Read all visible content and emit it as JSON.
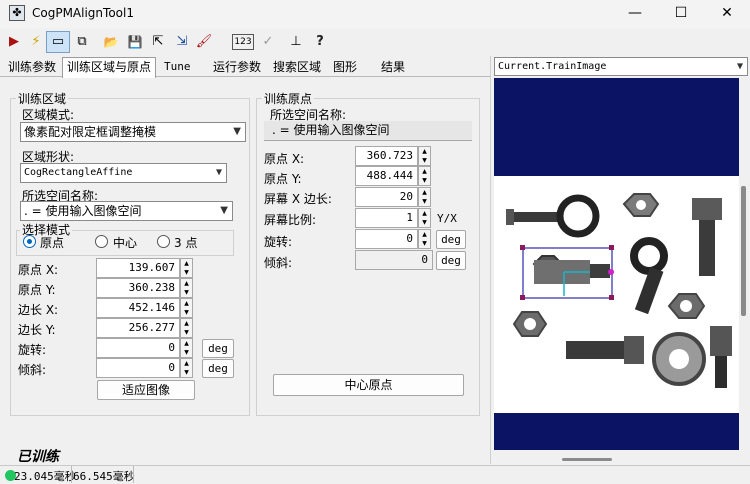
{
  "window": {
    "title": "CogPMAlignTool1",
    "minimize": "—",
    "maximize": "☐",
    "close": "✕"
  },
  "toolbar": {
    "icons": [
      "run-icon",
      "lightning-icon",
      "display-icon",
      "link-icon",
      "open-folder-icon",
      "save-icon",
      "export-icon",
      "import-icon",
      "brush-icon",
      "numeric-icon",
      "check-icon",
      "axis-icon",
      "help-icon"
    ],
    "run": "▶",
    "lightning": "⚡",
    "display": "▭",
    "link": "⧉",
    "open": "📂",
    "save": "💾",
    "export": "⇱",
    "import": "⇲",
    "brush": "🖌",
    "numeric": "123",
    "check": "✓",
    "axis": "⊥",
    "help": "?"
  },
  "tabs": [
    "训练参数",
    "训练区域与原点",
    "Tune",
    "运行参数",
    "搜索区域",
    "图形",
    "结果"
  ],
  "train_region": {
    "group_title": "训练区域",
    "mode_label": "区域模式:",
    "mode_value": "像素配对限定框调整掩模",
    "shape_label": "区域形状:",
    "shape_value": "CogRectangleAffine",
    "space_label": "所选空间名称:",
    "space_value": ". = 使用输入图像空间",
    "select_mode_title": "选择模式",
    "radio_origin": "原点",
    "radio_center": "中心",
    "radio_3pt": "3 点",
    "origin_x_label": "原点 X:",
    "origin_x": "139.607",
    "origin_y_label": "原点 Y:",
    "origin_y": "360.238",
    "side_x_label": "边长 X:",
    "side_x": "452.146",
    "side_y_label": "边长 Y:",
    "side_y": "256.277",
    "rotation_label": "旋转:",
    "rotation": "0",
    "skew_label": "倾斜:",
    "skew": "0",
    "deg": "deg",
    "fit_button": "适应图像"
  },
  "train_origin": {
    "group_title": "训练原点",
    "space_label": "所选空间名称:",
    "space_value": ". = 使用输入图像空间",
    "origin_x_label": "原点 X:",
    "origin_x": "360.723",
    "origin_y_label": "原点 Y:",
    "origin_y": "488.444",
    "screen_side_label": "屏幕 X 边长:",
    "screen_side": "20",
    "screen_ratio_label": "屏幕比例:",
    "screen_ratio": "1",
    "ratio_unit": "Y/X",
    "rotation_label": "旋转:",
    "rotation": "0",
    "skew_label": "倾斜:",
    "skew": "0",
    "deg": "deg",
    "center_button": "中心原点"
  },
  "trained_status": "已训练",
  "image_panel": {
    "selector": "Current.TrainImage"
  },
  "statusbar": {
    "time1": "23.045毫秒",
    "time2": "66.545毫秒",
    "status_color": "#22c55e"
  }
}
